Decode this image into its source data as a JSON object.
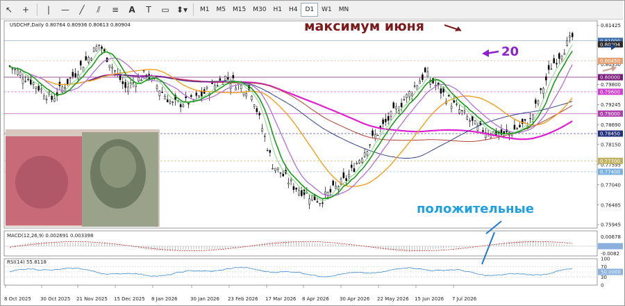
{
  "toolbar": {
    "icons": [
      "cursor-icon",
      "crosshair-icon",
      "vertical-line-icon",
      "horizontal-line-icon",
      "trendline-icon",
      "channel-icon",
      "text-icon",
      "label-icon",
      "shapes-icon",
      "arrow-tools-icon"
    ],
    "timeframes": [
      "M1",
      "M5",
      "M15",
      "M30",
      "H1",
      "H4",
      "D1",
      "W1",
      "MN"
    ],
    "active_timeframe": "D1"
  },
  "chart_data": {
    "type": "line",
    "title": "USDCHF,Daily  0.80764 0.80936 0.80613 0.80904",
    "y_ticks": [
      "0.81425",
      "0.80904",
      "0.80350",
      "0.79800",
      "0.79245",
      "0.78690",
      "0.78150",
      "0.77595",
      "0.77040",
      "0.76485",
      "0.75945"
    ],
    "price_tags": [
      {
        "label": "0.81000",
        "bg": "#3a6fb0",
        "fg": "#ffffff"
      },
      {
        "label": "0.80904",
        "bg": "#2b2b2b",
        "fg": "#ffffff"
      },
      {
        "label": "0.80450",
        "bg": "#e8a070",
        "fg": "#ffffff"
      },
      {
        "label": "0.80000",
        "bg": "#7a1a7a",
        "fg": "#ffffff"
      },
      {
        "label": "0.79600",
        "bg": "#d040d0",
        "fg": "#ffffff"
      },
      {
        "label": "0.79000",
        "bg": "#b040b0",
        "fg": "#ffffff"
      },
      {
        "label": "0.78450",
        "bg": "#22327a",
        "fg": "#ffffff"
      },
      {
        "label": "0.77700",
        "bg": "#c0b060",
        "fg": "#ffffff"
      },
      {
        "label": "0.77400",
        "bg": "#7ab0e0",
        "fg": "#ffffff"
      }
    ],
    "x_ticks": [
      "8 Oct 2025",
      "30 Oct 2025",
      "21 Nov 2025",
      "15 Dec 2025",
      "8 Jan 2026",
      "30 Jan 2026",
      "23 Feb 2026",
      "17 Mar 2026",
      "8 Apr 2026",
      "30 Apr 2026",
      "22 May 2026",
      "15 Jun 2026",
      "7 Jul 2026"
    ],
    "macd": {
      "label": "MACD(12,26,9) 0.002691 0.003398",
      "ticks": [
        "0.00678",
        "0.00000",
        "-0.0082"
      ]
    },
    "rsi": {
      "label": "RSI(14) 55.8118",
      "ticks": [
        "100",
        "70",
        "50.0000",
        "30",
        "0"
      ]
    },
    "annotations": {
      "june_max": "максимум июня",
      "twenty": "20",
      "positive": "положительные"
    },
    "colors": {
      "candles": "#000000",
      "ma_green": "#1a9a1a",
      "ma_light_green": "#90d890",
      "ma_violet": "#b070d0",
      "ma_orange": "#f0a020",
      "ma_magenta": "#e020d0",
      "ma_brown": "#b04030",
      "ma_navy": "#203080"
    }
  }
}
